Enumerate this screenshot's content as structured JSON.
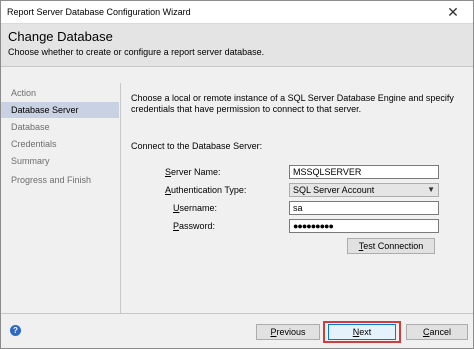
{
  "window": {
    "title": "Report Server Database Configuration Wizard",
    "close_label": "✕"
  },
  "header": {
    "title": "Change Database",
    "subtitle": "Choose whether to create or configure a report server database."
  },
  "sidebar": {
    "items": [
      {
        "label": "Action",
        "active": false
      },
      {
        "label": "Database Server",
        "active": true
      },
      {
        "label": "Database",
        "active": false
      },
      {
        "label": "Credentials",
        "active": false
      },
      {
        "label": "Summary",
        "active": false
      },
      {
        "label": "Progress and Finish",
        "active": false
      }
    ]
  },
  "content": {
    "description_line1": "Choose a local or remote instance of a SQL Server Database Engine and specify",
    "description_line2": "credentials that have permission to connect to that server.",
    "section_label": "Connect to the Database Server:",
    "server_name": {
      "label_u": "S",
      "label_rest": "erver Name:",
      "value": "MSSQLSERVER"
    },
    "auth_type": {
      "label_u": "A",
      "label_rest": "uthentication Type:",
      "value": "SQL Server Account"
    },
    "username": {
      "label_u": "U",
      "label_rest": "sername:",
      "value": "sa"
    },
    "password": {
      "label_u": "P",
      "label_rest": "assword:",
      "value": "●●●●●●●●●"
    },
    "test_connection": {
      "label_u": "T",
      "label_rest": "est Connection"
    }
  },
  "footer": {
    "help_icon": "?",
    "previous": {
      "label_u": "P",
      "label_rest": "revious"
    },
    "next": {
      "label_u": "N",
      "label_rest": "ext"
    },
    "cancel": {
      "label_u": "C",
      "label_rest": "ancel"
    },
    "highlight_color": "#d43c3c"
  }
}
